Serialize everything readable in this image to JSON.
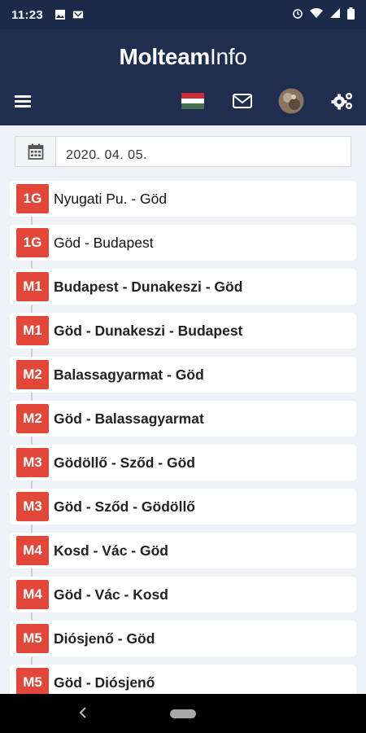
{
  "status_bar": {
    "time": "11:23"
  },
  "app": {
    "title_bold": "Molteam",
    "title_light": "Info"
  },
  "date": {
    "value": "2020. 04. 05."
  },
  "routes": [
    {
      "code": "1G",
      "name": "Nyugati Pu. - Göd"
    },
    {
      "code": "1G",
      "name": "Göd - Budapest"
    },
    {
      "code": "M1",
      "name": "Budapest - Dunakeszi - Göd"
    },
    {
      "code": "M1",
      "name": "Göd - Dunakeszi - Budapest"
    },
    {
      "code": "M2",
      "name": "Balassagyarmat - Göd"
    },
    {
      "code": "M2",
      "name": "Göd - Balassagyarmat"
    },
    {
      "code": "M3",
      "name": "Gödöllő - Sződ - Göd"
    },
    {
      "code": "M3",
      "name": "Göd - Sződ - Gödöllő"
    },
    {
      "code": "M4",
      "name": "Kosd - Vác - Göd"
    },
    {
      "code": "M4",
      "name": "Göd - Vác - Kosd"
    },
    {
      "code": "M5",
      "name": "Diósjenő - Göd"
    },
    {
      "code": "M5",
      "name": "Göd - Diósjenő"
    }
  ],
  "icons": {
    "menu": "hamburger-menu-icon",
    "language": "hungarian-flag-icon",
    "mail": "mail-icon",
    "profile": "avatar",
    "settings": "gears-icon",
    "calendar": "calendar-icon"
  },
  "colors": {
    "header": "#1f2d4f",
    "badge": "#e2473a",
    "background": "#eef1f6"
  }
}
